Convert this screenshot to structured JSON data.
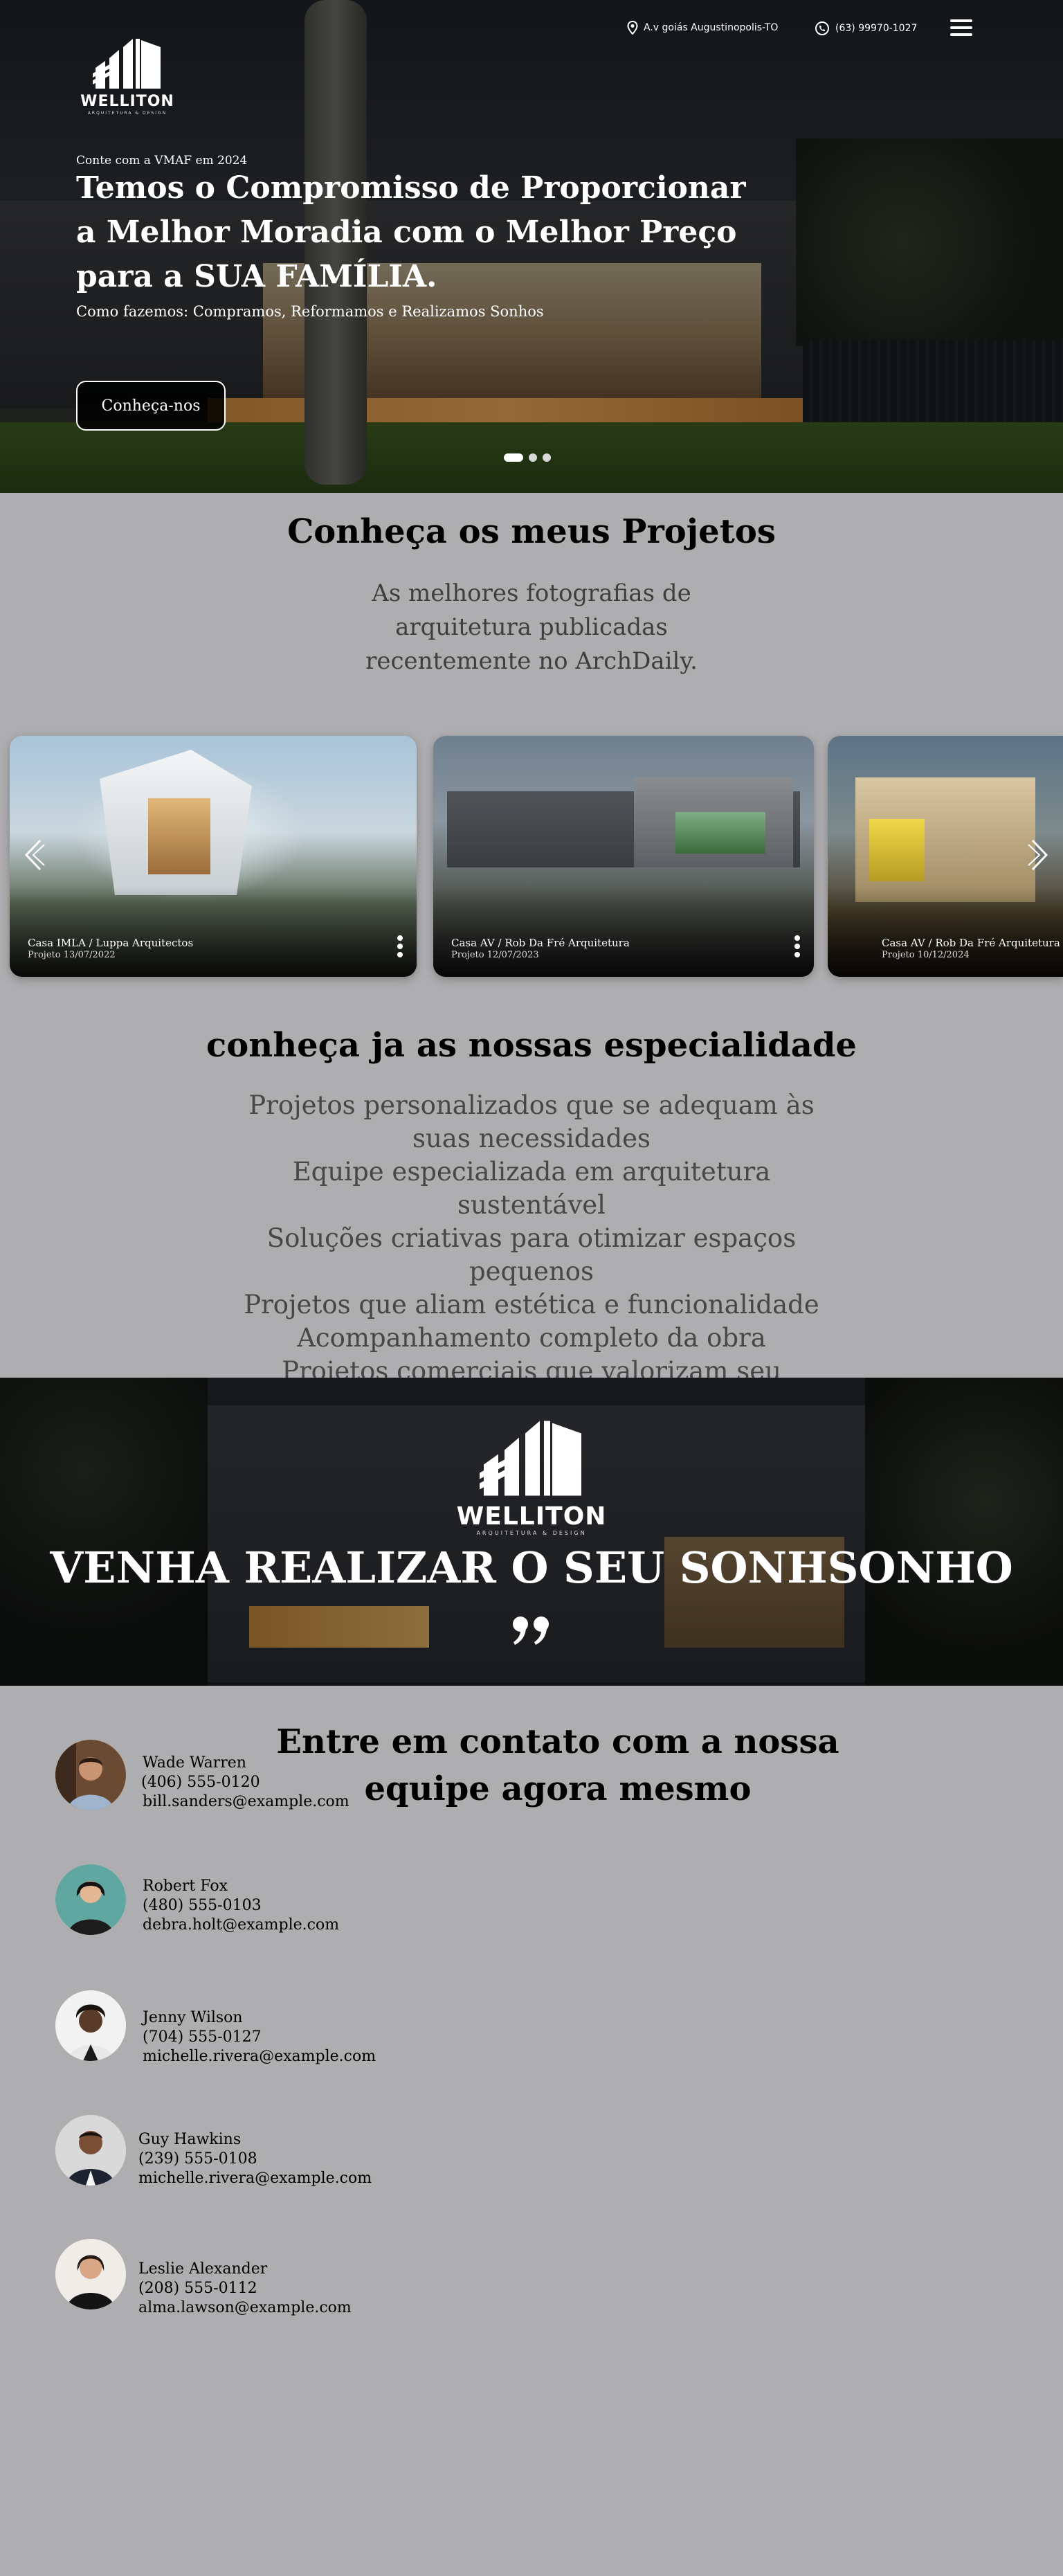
{
  "brand": {
    "name": "WELLITON",
    "tagline": "ARQUITETURA & DESIGN"
  },
  "header": {
    "address": "A.v goiás Augustinopolis-TO",
    "phone": "(63) 99970-1027"
  },
  "hero": {
    "kicker": "Conte com a VMAF em 2024",
    "title": "Temos o Compromisso de Proporcionar a Melhor Moradia com o Melhor Preço para a SUA FAMÍLIA.",
    "subtitle": "Como fazemos: Compramos, Reformamos e Realizamos Sonhos",
    "cta": "Conheça-nos",
    "slide_index": 1,
    "slide_count": 3
  },
  "projects": {
    "title": "Conheça os meus Projetos",
    "subtitle": "As melhores fotografias de arquitetura publicadas recentemente no ArchDaily.",
    "cards": [
      {
        "name": "Casa IMLA / Luppa Arquitectos",
        "date": "Projeto 13/07/2022"
      },
      {
        "name": "Casa AV / Rob Da Fré Arquitetura",
        "date": "Projeto 12/07/2023"
      },
      {
        "name": "Casa AV / Rob Da Fré Arquitetura",
        "date": "Projeto 10/12/2024"
      }
    ]
  },
  "specialities": {
    "title": "conheça ja as nossas especialidade",
    "items": [
      "Projetos personalizados que se adequam às suas necessidades",
      "Equipe especializada em arquitetura sustentável",
      "Soluções criativas para otimizar espaços pequenos",
      "Projetos que aliam estética e funcionalidade",
      "Acompanhamento completo da obra",
      "Projetos comerciais que valorizam seu negócio"
    ]
  },
  "banner": {
    "title": "VENHA REALIZAR O SEU SONHSONHO"
  },
  "contact": {
    "title": "Entre em contato com a nossa equipe agora mesmo",
    "people": [
      {
        "name": "Wade Warren",
        "phone": "(406) 555-0120",
        "email": "bill.sanders@example.com"
      },
      {
        "name": "Robert Fox",
        "phone": "(480) 555-0103",
        "email": "debra.holt@example.com"
      },
      {
        "name": "Jenny Wilson",
        "phone": "(704) 555-0127",
        "email": "michelle.rivera@example.com"
      },
      {
        "name": "Guy Hawkins",
        "phone": "(239) 555-0108",
        "email": "michelle.rivera@example.com"
      },
      {
        "name": "Leslie Alexander",
        "phone": "(208) 555-0112",
        "email": "alma.lawson@example.com"
      }
    ]
  },
  "colors": {
    "page_bg": "#aeadaf",
    "text_muted": "#474747",
    "button_bg": "#111111"
  }
}
